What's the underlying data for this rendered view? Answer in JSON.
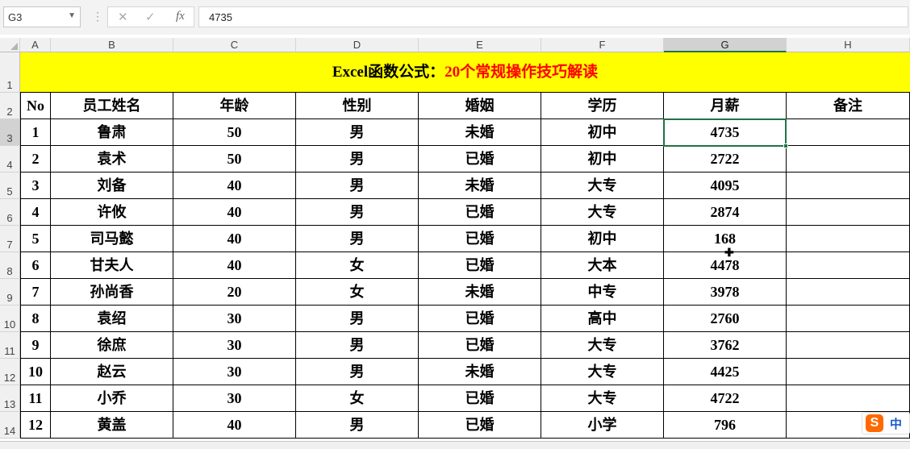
{
  "formula_bar": {
    "name_box": "G3",
    "cancel_icon": "✕",
    "enter_icon": "✓",
    "fx_icon": "fx",
    "formula_value": "4735"
  },
  "columns": [
    "A",
    "B",
    "C",
    "D",
    "E",
    "F",
    "G",
    "H"
  ],
  "selected_column": "G",
  "selected_row": "3",
  "rows": [
    "1",
    "2",
    "3",
    "4",
    "5",
    "6",
    "7",
    "8",
    "9",
    "10",
    "11",
    "12",
    "13",
    "14"
  ],
  "title": {
    "part1": "Excel函数公式：",
    "part2": "20个常规操作技巧解读"
  },
  "headers": [
    "No",
    "员工姓名",
    "年龄",
    "性别",
    "婚姻",
    "学历",
    "月薪",
    "备注"
  ],
  "table": [
    [
      "1",
      "鲁肃",
      "50",
      "男",
      "未婚",
      "初中",
      "4735",
      ""
    ],
    [
      "2",
      "袁术",
      "50",
      "男",
      "已婚",
      "初中",
      "2722",
      ""
    ],
    [
      "3",
      "刘备",
      "40",
      "男",
      "未婚",
      "大专",
      "4095",
      ""
    ],
    [
      "4",
      "许攸",
      "40",
      "男",
      "已婚",
      "大专",
      "2874",
      ""
    ],
    [
      "5",
      "司马懿",
      "40",
      "男",
      "已婚",
      "初中",
      "168",
      ""
    ],
    [
      "6",
      "甘夫人",
      "40",
      "女",
      "已婚",
      "大本",
      "4478",
      ""
    ],
    [
      "7",
      "孙尚香",
      "20",
      "女",
      "未婚",
      "中专",
      "3978",
      ""
    ],
    [
      "8",
      "袁绍",
      "30",
      "男",
      "已婚",
      "高中",
      "2760",
      ""
    ],
    [
      "9",
      "徐庶",
      "30",
      "男",
      "已婚",
      "大专",
      "3762",
      ""
    ],
    [
      "10",
      "赵云",
      "30",
      "男",
      "未婚",
      "大专",
      "4425",
      ""
    ],
    [
      "11",
      "小乔",
      "30",
      "女",
      "已婚",
      "大专",
      "4722",
      ""
    ],
    [
      "12",
      "黄盖",
      "40",
      "男",
      "已婚",
      "小学",
      "796",
      ""
    ]
  ],
  "ime": {
    "logo": "S",
    "mode": "中"
  },
  "colors": {
    "title_bg": "#ffff00",
    "title_red": "#ff0000",
    "selection": "#217346"
  }
}
